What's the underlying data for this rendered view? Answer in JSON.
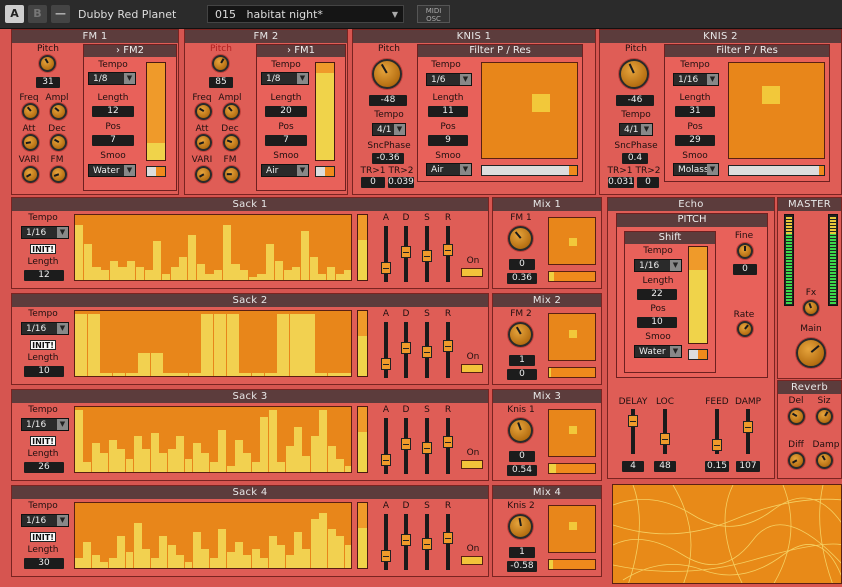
{
  "topbar": {
    "btn_a": "A",
    "btn_b": "B",
    "btn_menu": "—",
    "instrument": "Dubby Red Planet",
    "preset_num": "015",
    "preset_name": "habitat night*",
    "midi": "MIDI",
    "osc": "OSC"
  },
  "fm1": {
    "title": "FM 1",
    "pitch_label": "Pitch",
    "pitch": "31",
    "freq": "Freq",
    "ampl": "Ampl",
    "att": "Att",
    "dec": "Dec",
    "vari": "VARI",
    "fm": "FM",
    "sub_title": "› FM2",
    "tempo_label": "Tempo",
    "tempo": "1/8",
    "length_label": "Length",
    "length": "12",
    "pos_label": "Pos",
    "pos": "7",
    "smoo_label": "Smoo",
    "smoo": "Water",
    "bar_level": 0.18
  },
  "fm2": {
    "title": "FM 2",
    "pitch_label": "Pitch",
    "pitch": "85",
    "freq": "Freq",
    "ampl": "Ampl",
    "att": "Att",
    "dec": "Dec",
    "vari": "VARI",
    "fm": "FM",
    "sub_title": "› FM1",
    "tempo_label": "Tempo",
    "tempo": "1/8",
    "length_label": "Length",
    "length": "20",
    "pos_label": "Pos",
    "pos": "7",
    "smoo_label": "Smoo",
    "smoo": "Air",
    "bar_level": 0.9
  },
  "knis1": {
    "title": "KNIS 1",
    "pitch_label": "Pitch",
    "pitch": "-48",
    "tempo_label": "Tempo",
    "tempo": "4/1",
    "sncphase_label": "SncPhase",
    "sncphase": "-0.36",
    "tr1_label": "TR>1",
    "tr2_label": "TR>2",
    "tr1": "0",
    "tr2": "0.039",
    "sub_title": "Filter P / Res",
    "ftempo": "1/6",
    "length_label": "Length",
    "length": "11",
    "pos_label": "Pos",
    "pos": "9",
    "smoo_label": "Smoo",
    "smoo": "Air"
  },
  "knis2": {
    "title": "KNIS 2",
    "pitch_label": "Pitch",
    "pitch": "-46",
    "tempo_label": "Tempo",
    "tempo": "4/1",
    "sncphase_label": "SncPhase",
    "sncphase": "0.4",
    "tr1_label": "TR>1",
    "tr2_label": "TR>2",
    "tr1": "0.031",
    "tr2": "0",
    "sub_title": "Filter P / Res",
    "ftempo": "1/16",
    "length_label": "Length",
    "length": "31",
    "pos_label": "Pos",
    "pos": "29",
    "smoo_label": "Smoo",
    "smoo": "Molass"
  },
  "sacks": [
    {
      "title": "Sack 1",
      "tempo_label": "Tempo",
      "tempo": "1/16",
      "init": "INIT!",
      "length_label": "Length",
      "length": "12",
      "on": "On",
      "steps": [
        0.85,
        0.55,
        0.2,
        0.15,
        0.3,
        0.2,
        0.3,
        0.2,
        0.15,
        0.6,
        0.1,
        0.2,
        0.35,
        0.7,
        0.25,
        0.1,
        0.15,
        0.85,
        0.25,
        0.15,
        0.05,
        0.1,
        0.55,
        0.3,
        0.15,
        0.2,
        0.75,
        0.35,
        0.1,
        0.2,
        0.1,
        0.15
      ]
    },
    {
      "title": "Sack 2",
      "tempo_label": "Tempo",
      "tempo": "1/16",
      "init": "INIT!",
      "length_label": "Length",
      "length": "10",
      "on": "On",
      "steps": [
        0.95,
        0.95,
        0.05,
        0.05,
        0.05,
        0.35,
        0.35,
        0.05,
        0.05,
        0.05,
        0.95,
        0.95,
        0.95,
        0.05,
        0.05,
        0.05,
        0.95,
        0.95,
        0.95,
        0.05,
        0.05,
        0.05
      ]
    },
    {
      "title": "Sack 3",
      "tempo_label": "Tempo",
      "tempo": "1/16",
      "init": "INIT!",
      "length_label": "Length",
      "length": "26",
      "on": "On",
      "steps": [
        0.95,
        0.15,
        0.45,
        0.3,
        0.5,
        0.35,
        0.2,
        0.55,
        0.35,
        0.6,
        0.3,
        0.35,
        0.55,
        0.2,
        0.45,
        0.3,
        0.15,
        0.65,
        0.1,
        0.5,
        0.3,
        0.15,
        0.85,
        0.95,
        0.15,
        0.4,
        0.7,
        0.25,
        0.55,
        0.95,
        0.4,
        0.2,
        0.1
      ]
    },
    {
      "title": "Sack 4",
      "tempo_label": "Tempo",
      "tempo": "1/16",
      "init": "INIT!",
      "length_label": "Length",
      "length": "30",
      "on": "On",
      "steps": [
        0.15,
        0.4,
        0.2,
        0.1,
        0.15,
        0.5,
        0.25,
        0.7,
        0.3,
        0.15,
        0.5,
        0.35,
        0.2,
        0.1,
        0.55,
        0.3,
        0.15,
        0.6,
        0.25,
        0.4,
        0.2,
        0.3,
        0.15,
        0.5,
        0.35,
        0.2,
        0.55,
        0.3,
        0.75,
        0.85,
        0.6,
        0.5,
        0.35
      ]
    }
  ],
  "adsr": {
    "a": "A",
    "d": "D",
    "s": "S",
    "r": "R"
  },
  "mixes": [
    {
      "title": "Mix 1",
      "knob_label": "FM 1",
      "v1": "0",
      "v2": "0.36"
    },
    {
      "title": "Mix 2",
      "knob_label": "FM 2",
      "v1": "1",
      "v2": "0"
    },
    {
      "title": "Mix 3",
      "knob_label": "Knis 1",
      "v1": "0",
      "v2": "0.54"
    },
    {
      "title": "Mix 4",
      "knob_label": "Knis 2",
      "v1": "1",
      "v2": "-0.58"
    }
  ],
  "echo": {
    "title": "Echo",
    "pitch_title": "PITCH",
    "shift_title": "Shift",
    "tempo_label": "Tempo",
    "tempo": "1/16",
    "length_label": "Length",
    "length": "22",
    "pos_label": "Pos",
    "pos": "10",
    "smoo_label": "Smoo",
    "smoo": "Water",
    "fine_label": "Fine",
    "fine": "0",
    "rate_label": "Rate",
    "delay_label": "DELAY",
    "loc_label": "LOC",
    "feed_label": "FEED",
    "damp_label": "DAMP",
    "delay": "4",
    "loc": "48",
    "feed": "0.15",
    "damp": "107"
  },
  "master": {
    "title": "MASTER",
    "fx_label": "Fx",
    "main_label": "Main"
  },
  "reverb": {
    "title": "Reverb",
    "del": "Del",
    "siz": "Siz",
    "diff": "Diff",
    "damp": "Damp"
  },
  "colors": {
    "panel": "#df5d56",
    "orange": "#ef8a1c",
    "yellow": "#f2d150",
    "title_bar": "#5c3c3c"
  }
}
